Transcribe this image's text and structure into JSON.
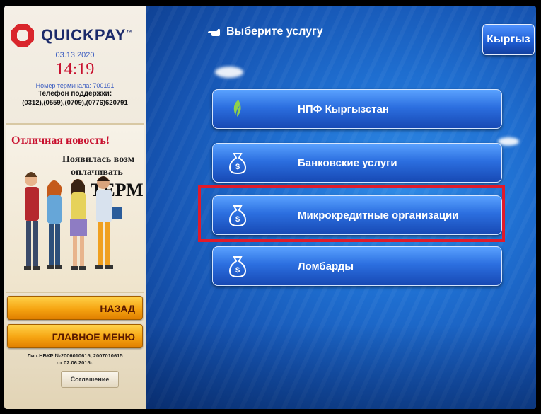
{
  "brand": {
    "name": "QUICKPAY",
    "tm": "™",
    "logo_color": "#d9262c"
  },
  "left_panel": {
    "date": "03.13.2020",
    "time": "14:19",
    "terminal": "Номер терминала: 700191",
    "support_title": "Телефон поддержки:",
    "support_phones": "(0312),(0559),(0709),(0776)620791"
  },
  "promo": {
    "title": "Отличная новость!",
    "line1": "Появилась возм",
    "line2": "оплачивать",
    "line3": "ТЕРМИ"
  },
  "nav": {
    "back_label": "НАЗАД",
    "main_menu_label": "ГЛАВНОЕ МЕНЮ",
    "license_text": "Лиц.НБКР №2006010615, 2007010615 от 02.06.2015г.",
    "agreement_label": "Соглашение"
  },
  "header": {
    "hint": "Выберите услугу",
    "language_button": "Кыргыз"
  },
  "services": [
    {
      "label": "НПФ Кыргызстан",
      "icon": "leaf-icon"
    },
    {
      "label": "Банковские услуги",
      "icon": "money-bag-icon"
    },
    {
      "label": "Микрокредитные организации",
      "icon": "money-bag-icon",
      "highlighted": true
    },
    {
      "label": "Ломбарды",
      "icon": "money-bag-icon"
    }
  ],
  "colors": {
    "highlight": "#e11a2a",
    "accent_blue": "#1f6fd1",
    "button_yellow": "#f6a411"
  }
}
